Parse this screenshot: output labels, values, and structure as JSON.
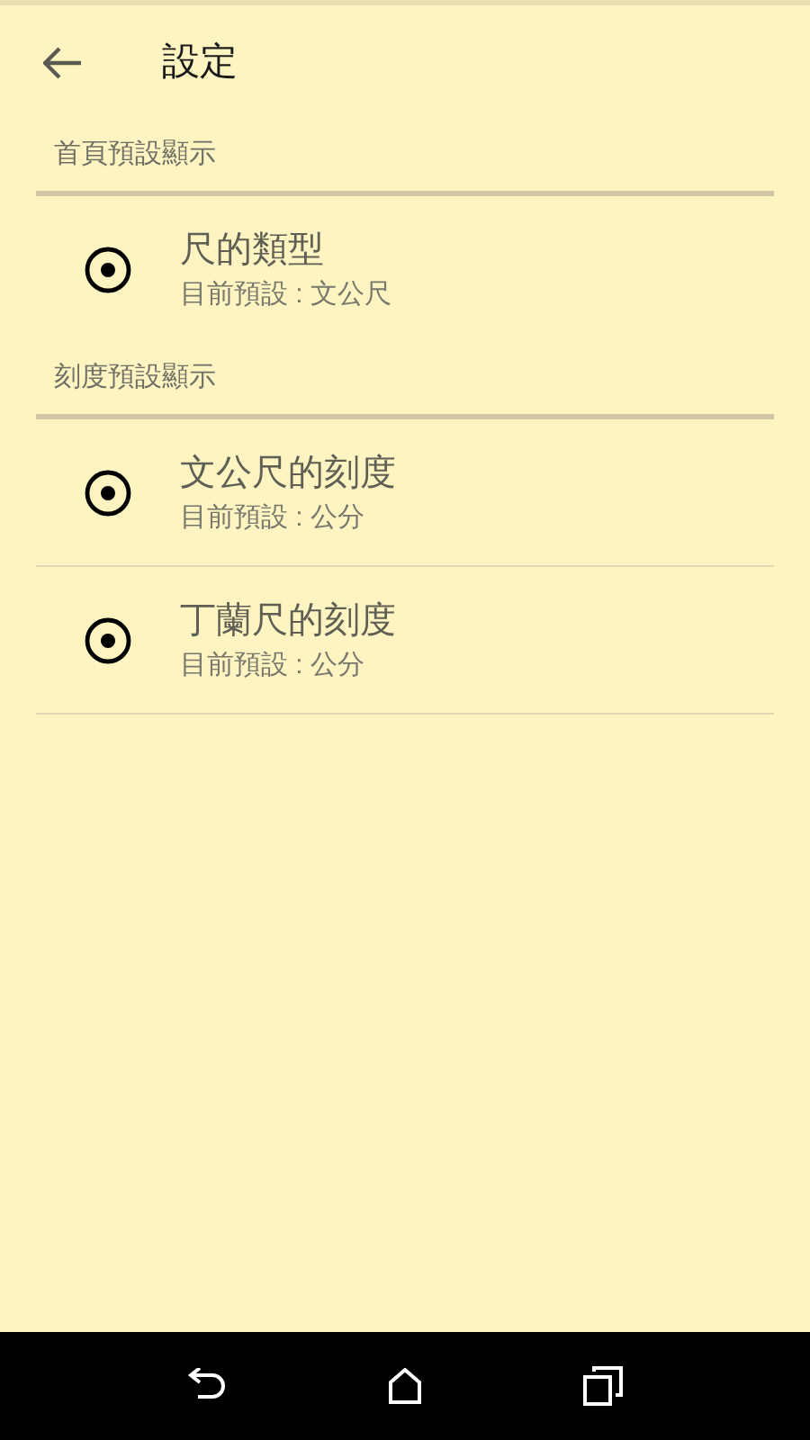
{
  "toolbar": {
    "title": "設定"
  },
  "sections": [
    {
      "header": "首頁預設顯示",
      "items": [
        {
          "title": "尺的類型",
          "summary": "目前預設 : 文公尺"
        }
      ]
    },
    {
      "header": "刻度預設顯示",
      "items": [
        {
          "title": "文公尺的刻度",
          "summary": "目前預設 : 公分"
        },
        {
          "title": "丁蘭尺的刻度",
          "summary": "目前預設 : 公分"
        }
      ]
    }
  ]
}
